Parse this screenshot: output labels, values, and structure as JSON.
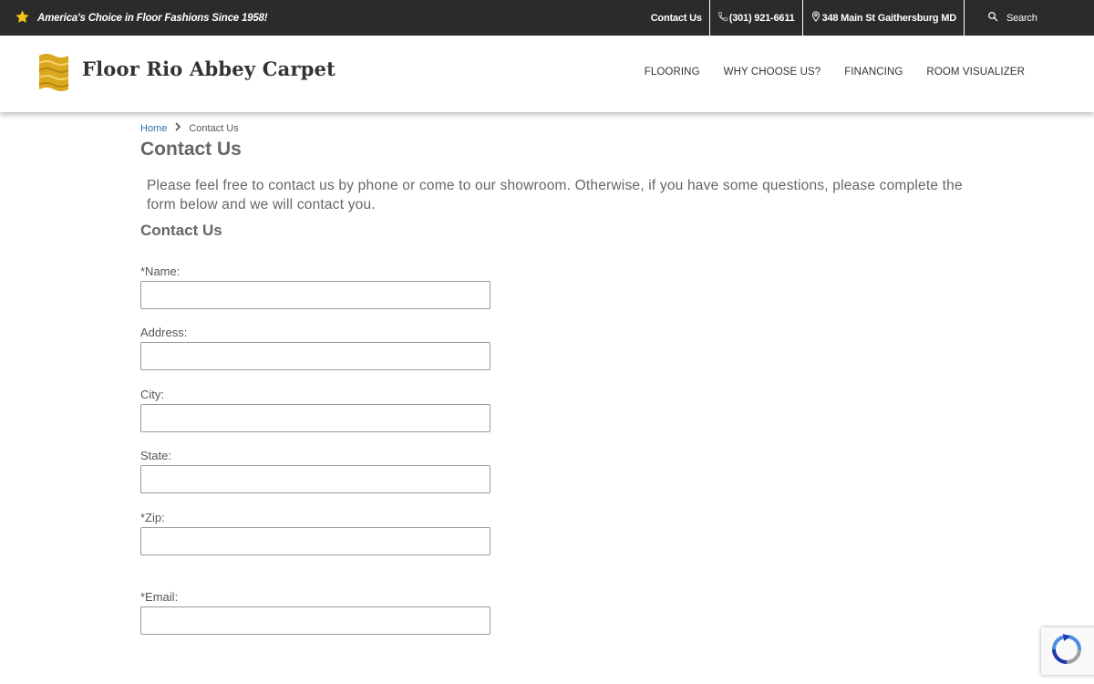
{
  "topbar": {
    "tagline": "America's Choice in Floor Fashions Since 1958!",
    "links": {
      "contact": "Contact Us",
      "phone": "(301) 921-6611",
      "address": "348 Main St Gaithersburg MD",
      "search": "Search"
    },
    "icons": [
      "star-icon",
      "phone-icon",
      "map-pin-icon",
      "search-icon"
    ]
  },
  "header": {
    "brand": "Floor Rio Abbey Carpet",
    "nav": [
      "FLOORING",
      "WHY CHOOSE US?",
      "FINANCING",
      "ROOM VISUALIZER"
    ]
  },
  "breadcrumb": {
    "home": "Home",
    "current": "Contact Us"
  },
  "page": {
    "title": "Contact Us",
    "intro": "Please feel free to contact us by phone or come to our showroom. Otherwise, if you have some questions, please complete the form below and we will contact you.",
    "form_title": "Contact Us"
  },
  "form": {
    "fields": [
      {
        "label": "*Name:",
        "value": ""
      },
      {
        "label": "Address:",
        "value": ""
      },
      {
        "label": "City:",
        "value": ""
      },
      {
        "label": "State:",
        "value": ""
      },
      {
        "label": "*Zip:",
        "value": ""
      },
      {
        "label": "*Email:",
        "value": ""
      }
    ]
  },
  "colors": {
    "topbar_bg": "#2b2b2b",
    "star": "#f5c518",
    "link_blue": "#2a6fb0",
    "logo_gold": "#d9a81e"
  }
}
